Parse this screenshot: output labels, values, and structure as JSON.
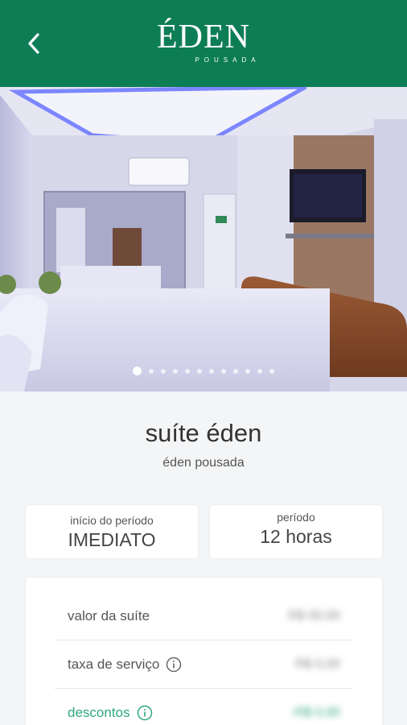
{
  "header": {
    "logo_main": "ÉDEN",
    "logo_sub": "POUSADA",
    "background_color": "#0d7d55"
  },
  "icons": {
    "back": "chevron-left-icon",
    "info": "info-circle-icon"
  },
  "gallery": {
    "image_count": 12,
    "active_index": 0
  },
  "suite": {
    "name": "suíte éden",
    "place": "éden pousada"
  },
  "period_start": {
    "label": "início do período",
    "value": "IMEDIATO"
  },
  "period": {
    "label": "período",
    "value": "12 horas"
  },
  "pricing": {
    "rows": [
      {
        "label": "valor da suíte",
        "value": "R$ 00,00"
      },
      {
        "label": "taxa de serviço",
        "value": "R$ 0,00"
      },
      {
        "label": "descontos",
        "value": "-R$ 0,00"
      }
    ],
    "discount_color": "#2ea97a"
  }
}
